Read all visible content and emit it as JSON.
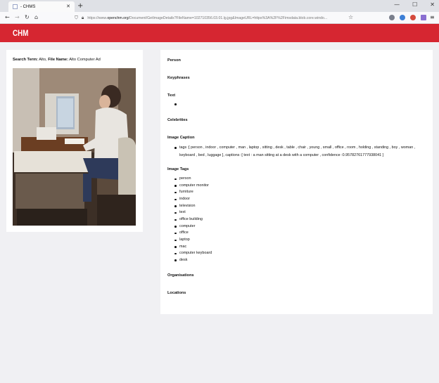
{
  "browser": {
    "tab_title": "- CHMS",
    "tab_close": "✕",
    "new_tab": "+",
    "url_prefix": "https://www.",
    "url_host": "openchm.org",
    "url_path": "/Document/GetImageDetails?FileName=102710356.03.01.lg.jpg&ImageURL=https%3A%2F%2Fimsdata.blob.core.windo...",
    "controls": {
      "minimize": "—",
      "maximize": "☐",
      "close": "✕"
    }
  },
  "site": {
    "logo": "CHM"
  },
  "left": {
    "search_term_label": "Search Term:",
    "search_term_value": "Alto,",
    "file_name_label": "File Name:",
    "file_name_value": "Alto Computer Ad"
  },
  "right": {
    "sections": {
      "person": "Person",
      "keyphrases": "Keyphrases",
      "text": "Text",
      "celebrities": "Celebrities",
      "image_caption": "Image Caption",
      "image_tags": "Image Tags",
      "organisations": "Organisations",
      "locations": "Locations"
    },
    "caption": "tags :[ person , indoor , computer , man , laptop , sitting , desk , table , chair , young , small , office , room , holding , standing , boy , woman , keyboard , bed , luggage ], captions :[ text : a man sitting at a desk with a computer , confidence :0.95782761777938041 ]",
    "tags": [
      "person",
      "computer monitor",
      "furniture",
      "indoor",
      "television",
      "text",
      "office building",
      "computer",
      "office",
      "laptop",
      "mac",
      "computer keyboard",
      "desk"
    ]
  },
  "colors": {
    "brand_red": "#d62631",
    "page_bg": "#f0f0f3"
  },
  "icons": [
    "back-icon",
    "forward-icon",
    "reload-icon",
    "home-icon",
    "shield-icon",
    "lock-icon",
    "star-icon",
    "menu-icon"
  ]
}
